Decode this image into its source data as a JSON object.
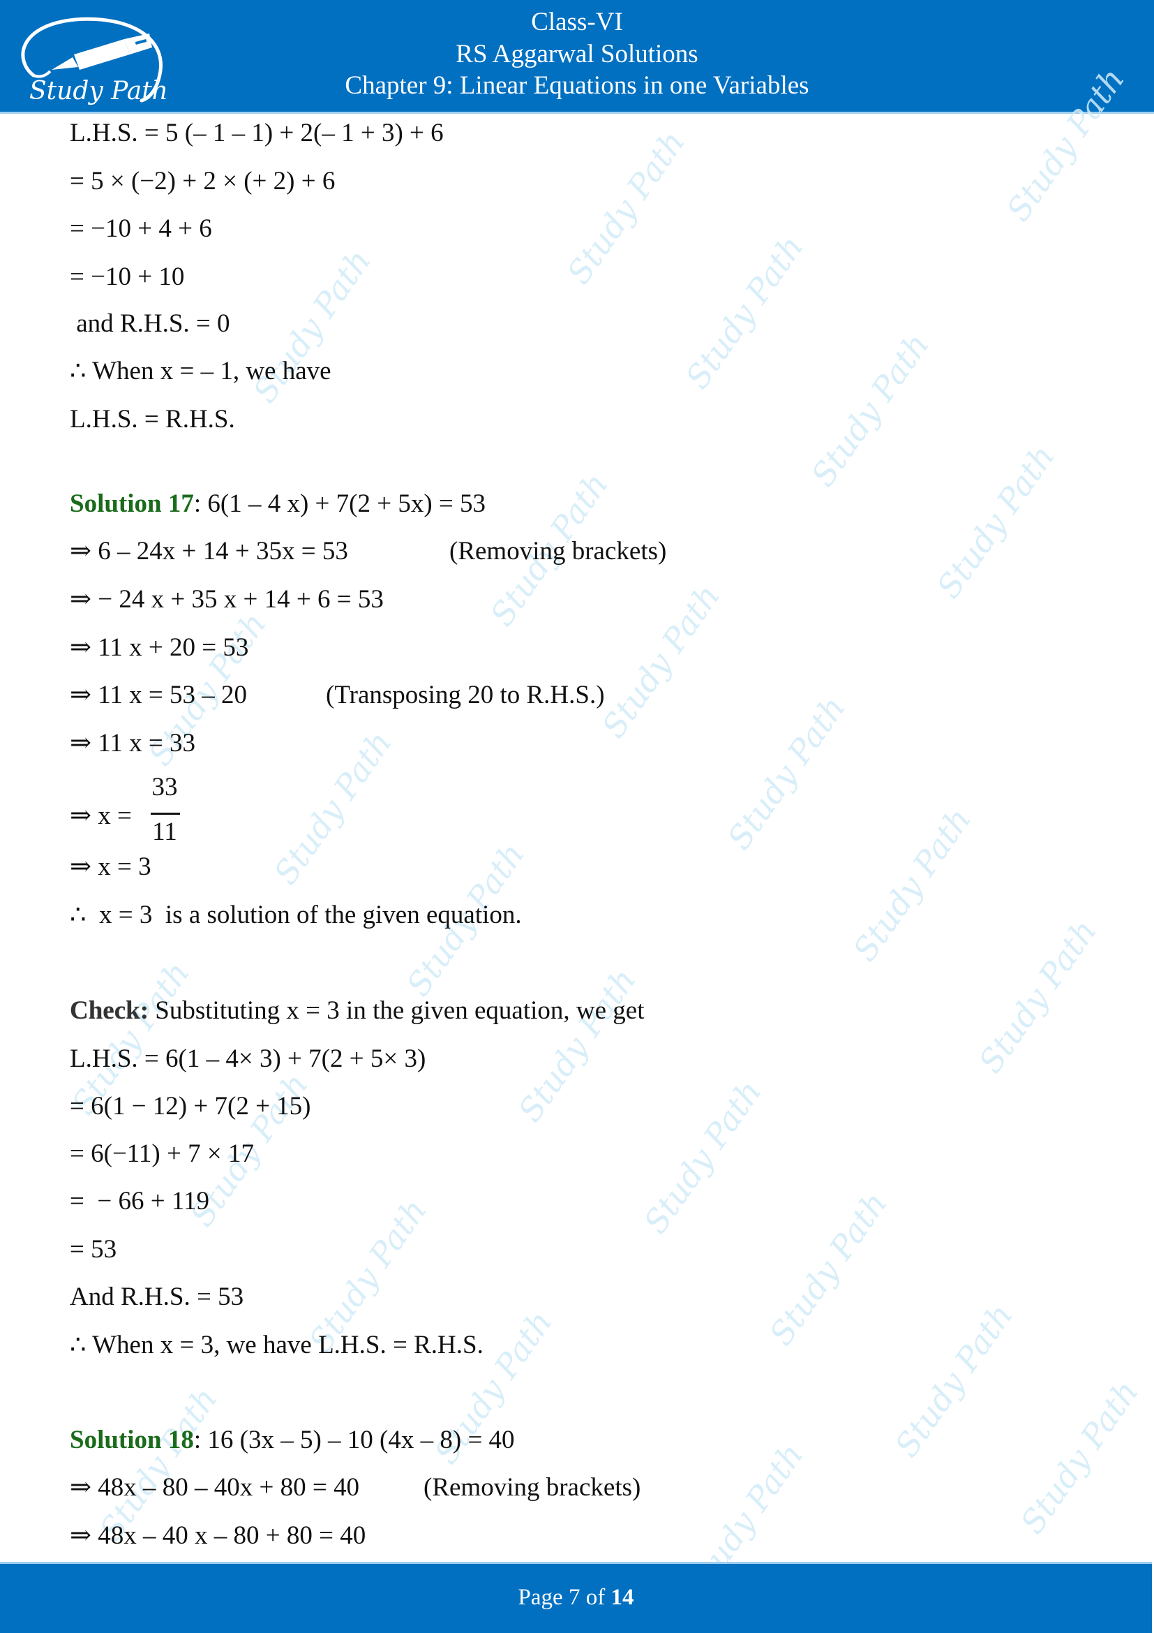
{
  "header": {
    "logo_text": "Study Path",
    "class": "Class-VI",
    "book": "RS Aggarwal Solutions",
    "chapter": "Chapter 9: Linear Equations in one Variables"
  },
  "watermark": "Study Path",
  "continuation": {
    "lines": [
      "L.H.S. = 5 (– 1 – 1) + 2(– 1 + 3) + 6",
      "= 5 × (−2) + 2 × (+ 2) + 6",
      "= −10 + 4 + 6",
      "= −10 + 10",
      " and R.H.S. = 0",
      "∴ When x = – 1, we have",
      "L.H.S. = R.H.S."
    ]
  },
  "solution17": {
    "label": "Solution 17",
    "equation": ": 6(1 – 4 x) + 7(2 + 5x) = 53",
    "steps": [
      {
        "text": "⇒ 6 – 24x + 14 + 35x = 53",
        "note": "(Removing brackets)"
      },
      {
        "text": "⇒ − 24 x + 35 x + 14 + 6 = 53",
        "note": ""
      },
      {
        "text": "⇒ 11 x + 20 = 53",
        "note": ""
      },
      {
        "text": "⇒ 11 x = 53 – 20",
        "note": "(Transposing 20 to R.H.S.)"
      },
      {
        "text": "⇒ 11 x = 33",
        "note": ""
      }
    ],
    "fraction": {
      "lead": "⇒ x = ",
      "numerator": "33",
      "denominator": "11"
    },
    "result": "⇒ x = 3",
    "conclusion": "∴  x = 3  is a solution of the given equation.",
    "check": {
      "label": "Check:",
      "intro": " Substituting x = 3 in the given equation, we get",
      "lines": [
        "L.H.S. = 6(1 – 4× 3) + 7(2 + 5× 3)",
        "= 6(1 − 12) + 7(2 + 15)",
        "= 6(−11) + 7 × 17",
        "=  − 66 + 119",
        "= 53",
        "And R.H.S. = 53",
        "∴ When x = 3, we have L.H.S. = R.H.S."
      ]
    }
  },
  "solution18": {
    "label": "Solution 18",
    "equation": ": 16 (3x – 5) – 10 (4x – 8) = 40",
    "steps": [
      {
        "text": "⇒ 48x – 80 – 40x + 80 = 40",
        "note": "(Removing brackets)"
      },
      {
        "text": "⇒ 48x – 40 x – 80 + 80 = 40",
        "note": ""
      }
    ]
  },
  "footer": {
    "page_label": "Page",
    "current_page": "7",
    "of_label": "of",
    "total_pages": "14"
  },
  "colors": {
    "brand_blue": "#0170c1",
    "solution_green": "#1a6b1a",
    "watermark": "#d2ecf8"
  }
}
